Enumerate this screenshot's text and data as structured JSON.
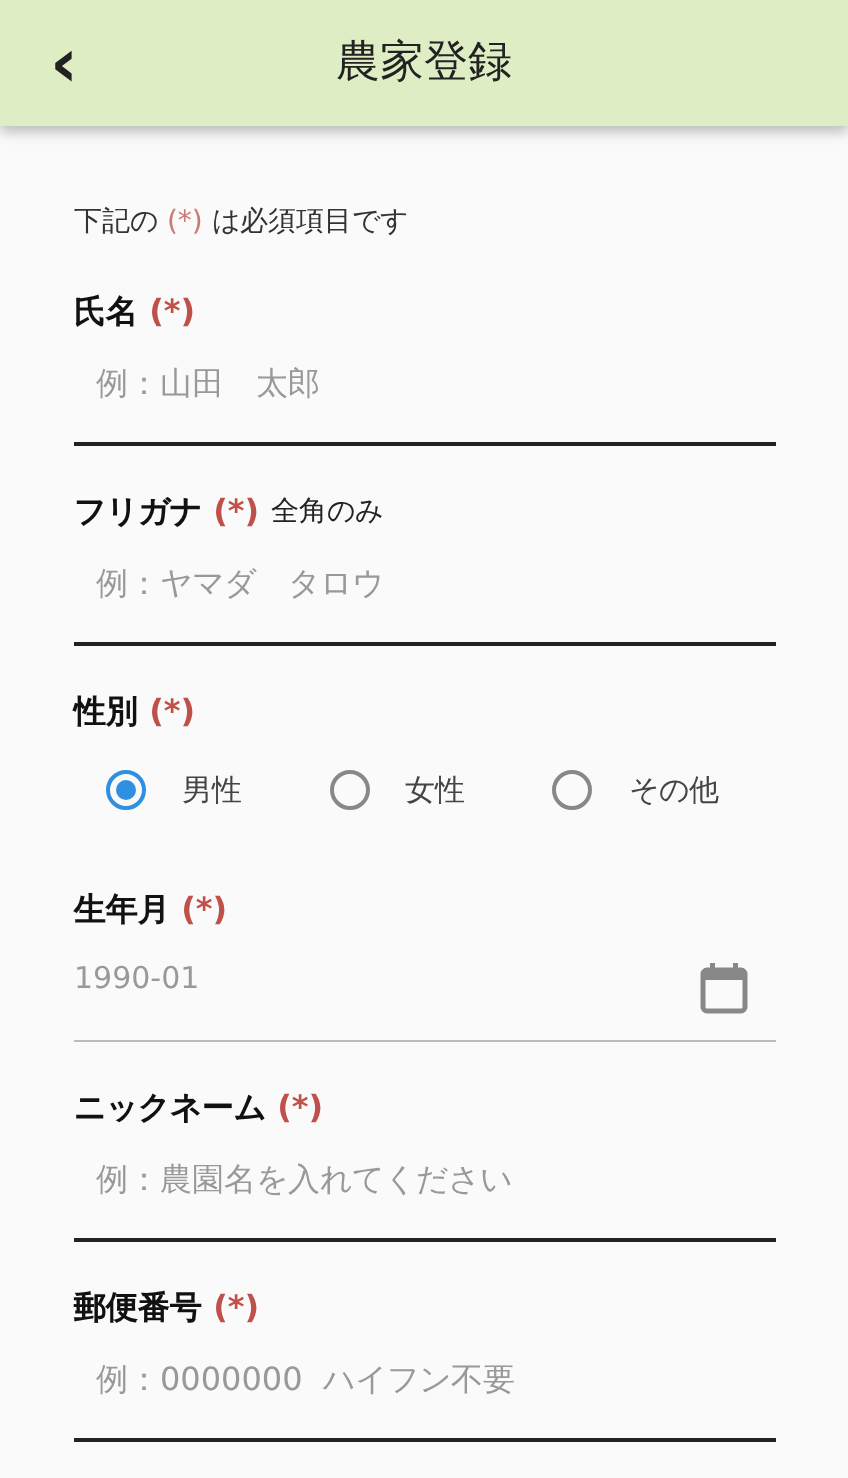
{
  "header": {
    "back": "‹",
    "title": "農家登録"
  },
  "note": {
    "before": "下記の",
    "mark": "(*)",
    "after": "は必須項目です"
  },
  "fields": [
    {
      "kind": "text",
      "label": "氏名",
      "required_mark": "(*)",
      "placeholder": "例：山田　太郎"
    },
    {
      "kind": "text",
      "label": "フリガナ",
      "required_mark": "(*)",
      "hint": "全角のみ",
      "placeholder": "例：ヤマダ　タロウ"
    },
    {
      "kind": "radio",
      "label": "性別",
      "required_mark": "(*)",
      "options": [
        {
          "label": "男性",
          "selected": true
        },
        {
          "label": "女性",
          "selected": false
        },
        {
          "label": "その他",
          "selected": false
        }
      ]
    },
    {
      "kind": "date",
      "label": "生年月",
      "required_mark": "(*)",
      "value": "1990-01"
    },
    {
      "kind": "text",
      "label": "ニックネーム",
      "required_mark": "(*)",
      "placeholder": "例：農園名を入れてください"
    },
    {
      "kind": "text",
      "label": "郵便番号",
      "required_mark": "(*)",
      "placeholder": "例：0000000  ハイフン不要"
    }
  ]
}
